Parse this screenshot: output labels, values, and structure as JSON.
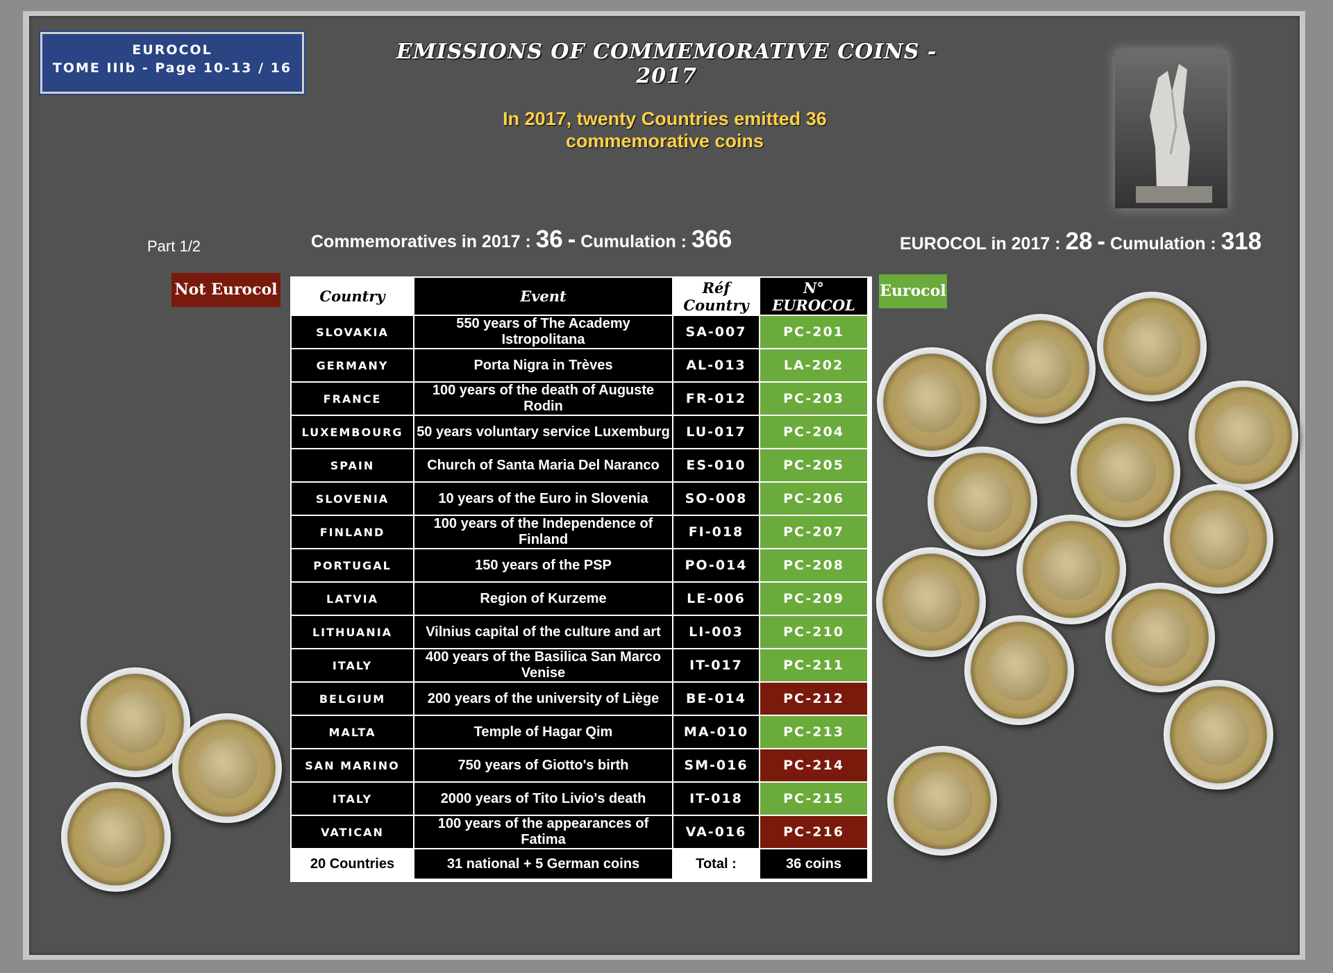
{
  "badge": {
    "line1": "EUROCOL",
    "line2": "TOME IIIb - Page 10-13 / 16"
  },
  "title": "EMISSIONS OF COMMEMORATIVE COINS - 2017",
  "subtitle": {
    "line1": "In 2017, twenty Countries emitted 36",
    "line2": "commemorative coins"
  },
  "part_label": "Part 1/2",
  "stats": {
    "commemoratives_label": "Commemoratives in 2017 :",
    "commemoratives_value": "36",
    "dash": "-",
    "cumulation_label": "Cumulation :",
    "cumulation_value": "366",
    "eurocol_label": "EUROCOL in 2017 :",
    "eurocol_value": "28",
    "eurocol_cumulation_label": "Cumulation :",
    "eurocol_cumulation_value": "318"
  },
  "legend": {
    "not_eurocol": "Not Eurocol",
    "eurocol": "Eurocol"
  },
  "table": {
    "headers": [
      "Country",
      "Event",
      "Réf Country",
      "N° EUROCOL"
    ],
    "rows": [
      {
        "country": "SLOVAKIA",
        "event": "550 years of The Academy Istropolitana",
        "ref": "SA-007",
        "eurocol": "PC-201",
        "status": "eurocol"
      },
      {
        "country": "GERMANY",
        "event": "Porta Nigra in Trèves",
        "ref": "AL-013",
        "eurocol": "LA-202",
        "status": "eurocol"
      },
      {
        "country": "FRANCE",
        "event": "100 years of the death of Auguste Rodin",
        "ref": "FR-012",
        "eurocol": "PC-203",
        "status": "eurocol"
      },
      {
        "country": "LUXEMBOURG",
        "event": "50 years voluntary service Luxemburg",
        "ref": "LU-017",
        "eurocol": "PC-204",
        "status": "eurocol"
      },
      {
        "country": "SPAIN",
        "event": "Church of Santa Maria Del Naranco",
        "ref": "ES-010",
        "eurocol": "PC-205",
        "status": "eurocol"
      },
      {
        "country": "SLOVENIA",
        "event": "10 years of the Euro in Slovenia",
        "ref": "SO-008",
        "eurocol": "PC-206",
        "status": "eurocol"
      },
      {
        "country": "FINLAND",
        "event": "100 years of the Independence of Finland",
        "ref": "FI-018",
        "eurocol": "PC-207",
        "status": "eurocol"
      },
      {
        "country": "PORTUGAL",
        "event": "150 years of the PSP",
        "ref": "PO-014",
        "eurocol": "PC-208",
        "status": "eurocol"
      },
      {
        "country": "LATVIA",
        "event": "Region of Kurzeme",
        "ref": "LE-006",
        "eurocol": "PC-209",
        "status": "eurocol"
      },
      {
        "country": "LITHUANIA",
        "event": "Vilnius capital of the culture and art",
        "ref": "LI-003",
        "eurocol": "PC-210",
        "status": "eurocol"
      },
      {
        "country": "ITALY",
        "event": "400 years of the Basilica San Marco Venise",
        "ref": "IT-017",
        "eurocol": "PC-211",
        "status": "eurocol"
      },
      {
        "country": "BELGIUM",
        "event": "200 years of the university of Liège",
        "ref": "BE-014",
        "eurocol": "PC-212",
        "status": "not_eurocol"
      },
      {
        "country": "MALTA",
        "event": "Temple of Hagar Qim",
        "ref": "MA-010",
        "eurocol": "PC-213",
        "status": "eurocol"
      },
      {
        "country": "SAN MARINO",
        "event": "750 years of Giotto's birth",
        "ref": "SM-016",
        "eurocol": "PC-214",
        "status": "not_eurocol"
      },
      {
        "country": "ITALY",
        "event": "2000 years of Tito Livio's death",
        "ref": "IT-018",
        "eurocol": "PC-215",
        "status": "eurocol"
      },
      {
        "country": "VATICAN",
        "event": "100 years of the appearances of Fatima",
        "ref": "VA-016",
        "eurocol": "PC-216",
        "status": "not_eurocol"
      }
    ],
    "footer": {
      "countries": "20  Countries",
      "event": "31  national + 5 German coins",
      "total_label": "Total :",
      "total": "36  coins"
    }
  },
  "colors": {
    "eurocol": "#6aab3b",
    "not_eurocol": "#7a1a0c",
    "badge": "#2a4484",
    "subtitle": "#ffd24a"
  }
}
